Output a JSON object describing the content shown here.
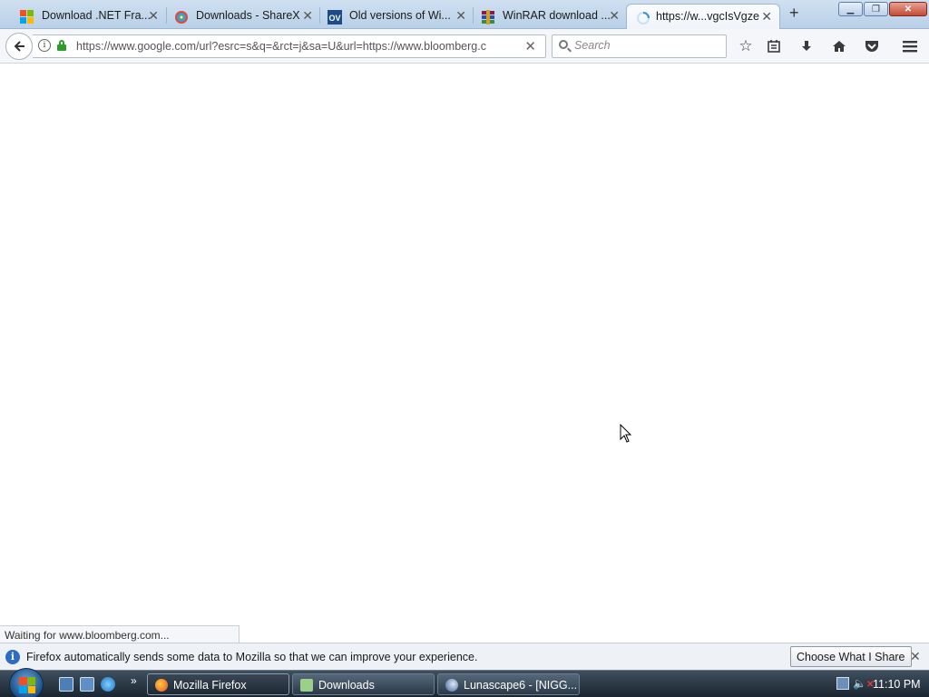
{
  "tabs": [
    {
      "label": "Download .NET Fra...",
      "icon": "windows-logo-icon"
    },
    {
      "label": "Downloads - ShareX",
      "icon": "sharex-icon"
    },
    {
      "label": "Old versions of Wi...",
      "icon": "oldversion-ov-icon",
      "icon_text": "OV"
    },
    {
      "label": "WinRAR download ...",
      "icon": "winrar-icon"
    },
    {
      "label": "https://w...vgcIsVgze",
      "icon": "loading-spinner-icon",
      "active": true
    }
  ],
  "toolbar": {
    "url": "https://www.google.com/url?esrc=s&q=&rct=j&sa=U&url=https://www.bloomberg.c",
    "search_placeholder": "Search"
  },
  "status": {
    "text": "Waiting for www.bloomberg.com..."
  },
  "notification": {
    "message": "Firefox automatically sends some data to Mozilla so that we can improve your experience.",
    "button": "Choose What I Share"
  },
  "taskbar": {
    "items": [
      {
        "label": "Mozilla Firefox",
        "active": true
      },
      {
        "label": "Downloads"
      },
      {
        "label": "Lunascape6 - [NIGG..."
      }
    ],
    "clock": "11:10 PM"
  },
  "colors": {
    "tabstrip": "#c5d9ee",
    "accent_blue": "#2b6cc4",
    "lock_green": "#2c9c2c"
  }
}
